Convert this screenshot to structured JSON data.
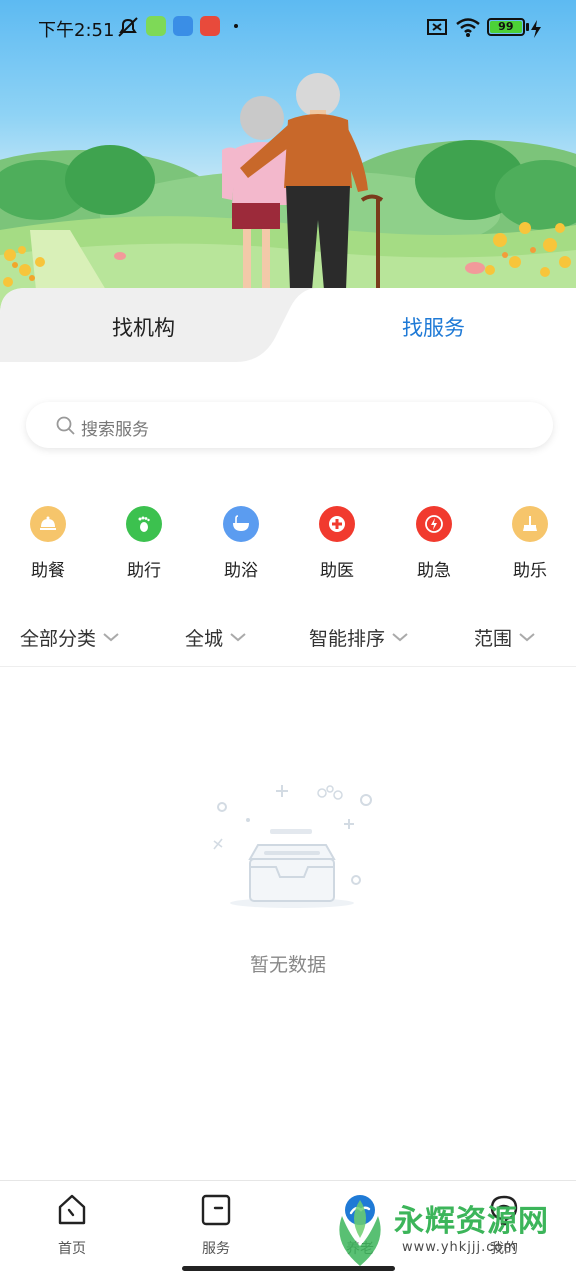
{
  "status_bar": {
    "time": "下午2:51",
    "battery": "99",
    "battery_color": "#4cd137"
  },
  "tabs": {
    "left_label": "找机构",
    "right_label": "找服务",
    "active": "找服务",
    "active_color": "#1f7ad6"
  },
  "search": {
    "placeholder": "搜索服务",
    "icon": "search-icon"
  },
  "categories": [
    {
      "label": "助餐",
      "icon": "cloche-icon",
      "color": "#f6c56b"
    },
    {
      "label": "助行",
      "icon": "footprint-icon",
      "color": "#3cc14f"
    },
    {
      "label": "助浴",
      "icon": "bathtub-icon",
      "color": "#5b9cf0"
    },
    {
      "label": "助医",
      "icon": "medical-cross-icon",
      "color": "#f13a2e"
    },
    {
      "label": "助急",
      "icon": "lightning-icon",
      "color": "#f13a2e"
    },
    {
      "label": "助乐",
      "icon": "broom-icon",
      "color": "#f6c56b"
    }
  ],
  "filters": [
    "全部分类",
    "全城",
    "智能排序",
    "范围"
  ],
  "empty_state": {
    "text": "暂无数据",
    "icon": "empty-inbox-icon"
  },
  "bottom_nav": [
    {
      "label": "首页",
      "icon": "home-icon"
    },
    {
      "label": "服务",
      "icon": "service-icon"
    },
    {
      "label": "养老",
      "icon": "elderly-care-icon",
      "active": true,
      "active_color": "#1f7ad6"
    },
    {
      "label": "我的",
      "icon": "profile-icon"
    }
  ],
  "watermark": {
    "title": "永辉资源网",
    "url": "www.yhkjjj.com"
  }
}
